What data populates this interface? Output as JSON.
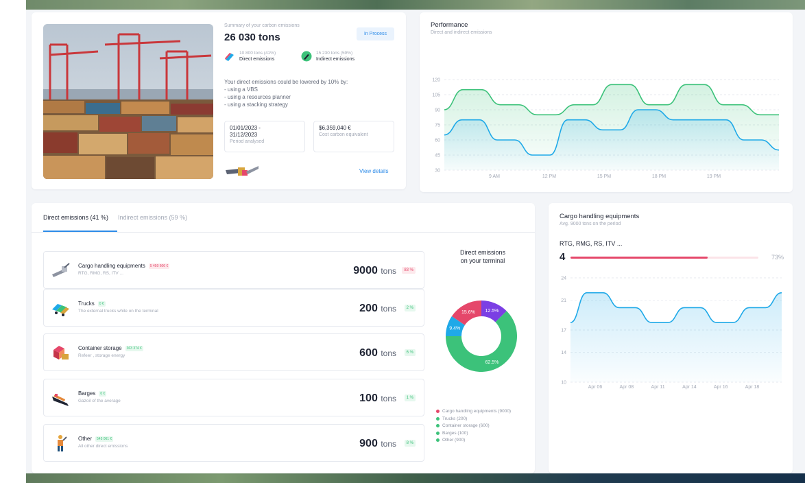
{
  "summary": {
    "label": "Summary of your carbon emissions",
    "total": "26 030 tons",
    "status": "In Process",
    "direct": {
      "amount": "10 800 tons (41%)",
      "label": "Direct emissions"
    },
    "indirect": {
      "amount": "15 230 tons (59%)",
      "label": "Indirect emissions"
    },
    "advice_title": "Your direct emissions could be lowered by 10% by:",
    "advice_items": [
      "- using a VBS",
      "- using a resources planner",
      "- using a stacking strategy"
    ],
    "period": {
      "value_line1": "01/01/2023 -",
      "value_line2": "31/12/2023",
      "label": "Period analysed"
    },
    "cost": {
      "value": "$6,359,040 €",
      "label": "Cost carbon equivalent"
    },
    "view_details": "View details"
  },
  "performance": {
    "title": "Performance",
    "subtitle": "Direct and indirect emissions"
  },
  "tabs": {
    "direct": "Direct emissions (41 %)",
    "indirect": "Indirect emissions (59 %)"
  },
  "emissions": [
    {
      "name": "Cargo handling equipments",
      "money": "5 450 606 €",
      "money_color": "red",
      "desc": "RTG, RMG, RS, ITV ...",
      "value": "9000",
      "unit": "tons",
      "pct": "83 %",
      "pct_color": "red",
      "icon": "crane-icon"
    },
    {
      "name": "Trucks",
      "money": "0 €",
      "money_color": "green",
      "desc": "The external trucks while on the terminal",
      "value": "200",
      "unit": "tons",
      "pct": "2 %",
      "pct_color": "green",
      "icon": "truck-icon"
    },
    {
      "name": "Container storage",
      "money": "363 374 €",
      "money_color": "green",
      "desc": "Refeer , storage energy",
      "value": "600",
      "unit": "tons",
      "pct": "6 %",
      "pct_color": "green",
      "icon": "container-icon"
    },
    {
      "name": "Barges",
      "money": "0 €",
      "money_color": "green",
      "desc": "Gazoil of the average",
      "value": "100",
      "unit": "tons",
      "pct": "1 %",
      "pct_color": "green",
      "icon": "barge-icon"
    },
    {
      "name": "Other",
      "money": "545 061 €",
      "money_color": "green",
      "desc": "All other direct emissions",
      "value": "900",
      "unit": "tons",
      "pct": "8 %",
      "pct_color": "green",
      "icon": "worker-icon"
    }
  ],
  "donut": {
    "title_line1": "Direct emissions",
    "title_line2": "on your terminal"
  },
  "legend": [
    {
      "label": "Cargo handling equipments (9000)",
      "color": "#e5476a"
    },
    {
      "label": "Trucks (200)",
      "color": "#3cc27a"
    },
    {
      "label": "Container storage (600)",
      "color": "#3cc27a"
    },
    {
      "label": "Barges (100)",
      "color": "#3cc27a"
    },
    {
      "label": "Other (900)",
      "color": "#3cc27a"
    }
  ],
  "cargo": {
    "title": "Cargo handling equipments",
    "subtitle": "Avg. 9000 tons on the period",
    "rtg_label": "RTG, RMG, RS, ITV ...",
    "count": "4",
    "progress": 0.73,
    "progress_label": "73%"
  },
  "colors": {
    "green": "#3cc27a",
    "blue": "#1fa9e8",
    "red": "#e5476a",
    "purple": "#7b3fe4",
    "accent": "#2d8be8"
  },
  "chart_data": [
    {
      "type": "line",
      "title": "Performance",
      "subtitle": "Direct and indirect emissions",
      "x": [
        "9 AM",
        "12 PM",
        "15 PM",
        "18 PM",
        "19 PM"
      ],
      "ylim": [
        30,
        120
      ],
      "yticks": [
        30,
        45,
        60,
        75,
        90,
        105,
        120
      ],
      "grid": true,
      "series": [
        {
          "color": "#3cc27a",
          "values": [
            90,
            110,
            110,
            95,
            95,
            85,
            85,
            95,
            95,
            115,
            115,
            95,
            95,
            115,
            115,
            95,
            95,
            85,
            85
          ]
        },
        {
          "color": "#1fa9e8",
          "values": [
            65,
            80,
            80,
            60,
            60,
            45,
            45,
            80,
            80,
            70,
            70,
            90,
            90,
            80,
            80,
            80,
            80,
            60,
            60,
            50
          ]
        }
      ]
    },
    {
      "type": "pie",
      "title": "Direct emissions on your terminal",
      "slices": [
        {
          "label": "Cargo handling equipments",
          "value": 15.6,
          "color": "#e5476a"
        },
        {
          "label": "12.5%",
          "value": 12.5,
          "color": "#7b3fe4"
        },
        {
          "label": "62.5%",
          "value": 62.5,
          "color": "#3cc27a"
        },
        {
          "label": "9.4%",
          "value": 9.4,
          "color": "#1fa9e8"
        }
      ],
      "slice_labels": [
        "15.6%",
        "12.5%",
        "62.5%",
        "9.4%"
      ]
    },
    {
      "type": "area",
      "title": "Cargo handling equipments",
      "x": [
        "Apr 06",
        "Apr 08",
        "Apr 11",
        "Apr 14",
        "Apr 16",
        "Apr 18"
      ],
      "ylim": [
        10,
        24
      ],
      "yticks": [
        10,
        14,
        17,
        21,
        24
      ],
      "grid": true,
      "series": [
        {
          "color": "#1fa9e8",
          "values": [
            18,
            22,
            22,
            20,
            20,
            18,
            18,
            20,
            20,
            18,
            18,
            20,
            20,
            22
          ]
        }
      ]
    }
  ]
}
